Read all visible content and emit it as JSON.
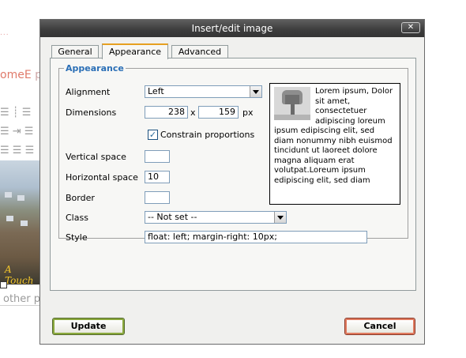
{
  "background": {
    "link_fragment": "...",
    "welcome_fragment_a": "omeE",
    "welcome_fragment_b": "p",
    "toolbar_icons": [
      "align-left-icon",
      "indent-icon",
      "justify-icon"
    ],
    "image_caption_fragment": "A Touch",
    "other_fragment": "other p"
  },
  "dialog": {
    "title": "Insert/edit image",
    "close_glyph": "✕",
    "tabs": [
      {
        "label": "General",
        "active": false
      },
      {
        "label": "Appearance",
        "active": true
      },
      {
        "label": "Advanced",
        "active": false
      }
    ],
    "fieldset_legend": "Appearance",
    "alignment": {
      "label": "Alignment",
      "value": "Left"
    },
    "dimensions": {
      "label": "Dimensions",
      "width": "238",
      "separator": "x",
      "height": "159",
      "unit": "px"
    },
    "constrain": {
      "label": "Constrain proportions",
      "checked": true
    },
    "vertical_space": {
      "label": "Vertical space",
      "value": ""
    },
    "horizontal_space": {
      "label": "Horizontal space",
      "value": "10"
    },
    "border": {
      "label": "Border",
      "value": ""
    },
    "class_field": {
      "label": "Class",
      "value": "-- Not set --"
    },
    "style_field": {
      "label": "Style",
      "value": "float: left; margin-right: 10px;"
    },
    "preview_text": "Lorem ipsum, Dolor sit amet, consectetuer adipiscing loreum ipsum edipiscing elit, sed diam nonummy nibh euismod tincidunt ut laoreet dolore magna aliquam erat volutpat.Loreum ipsum edipiscing elit, sed diam",
    "update_label": "Update",
    "cancel_label": "Cancel"
  },
  "colors": {
    "title_bar": "#3e3e3e",
    "legend": "#2b6fb6",
    "active_tab_accent": "#e6a020",
    "update_border": "#8aa83c",
    "cancel_border": "#e07a5f"
  }
}
